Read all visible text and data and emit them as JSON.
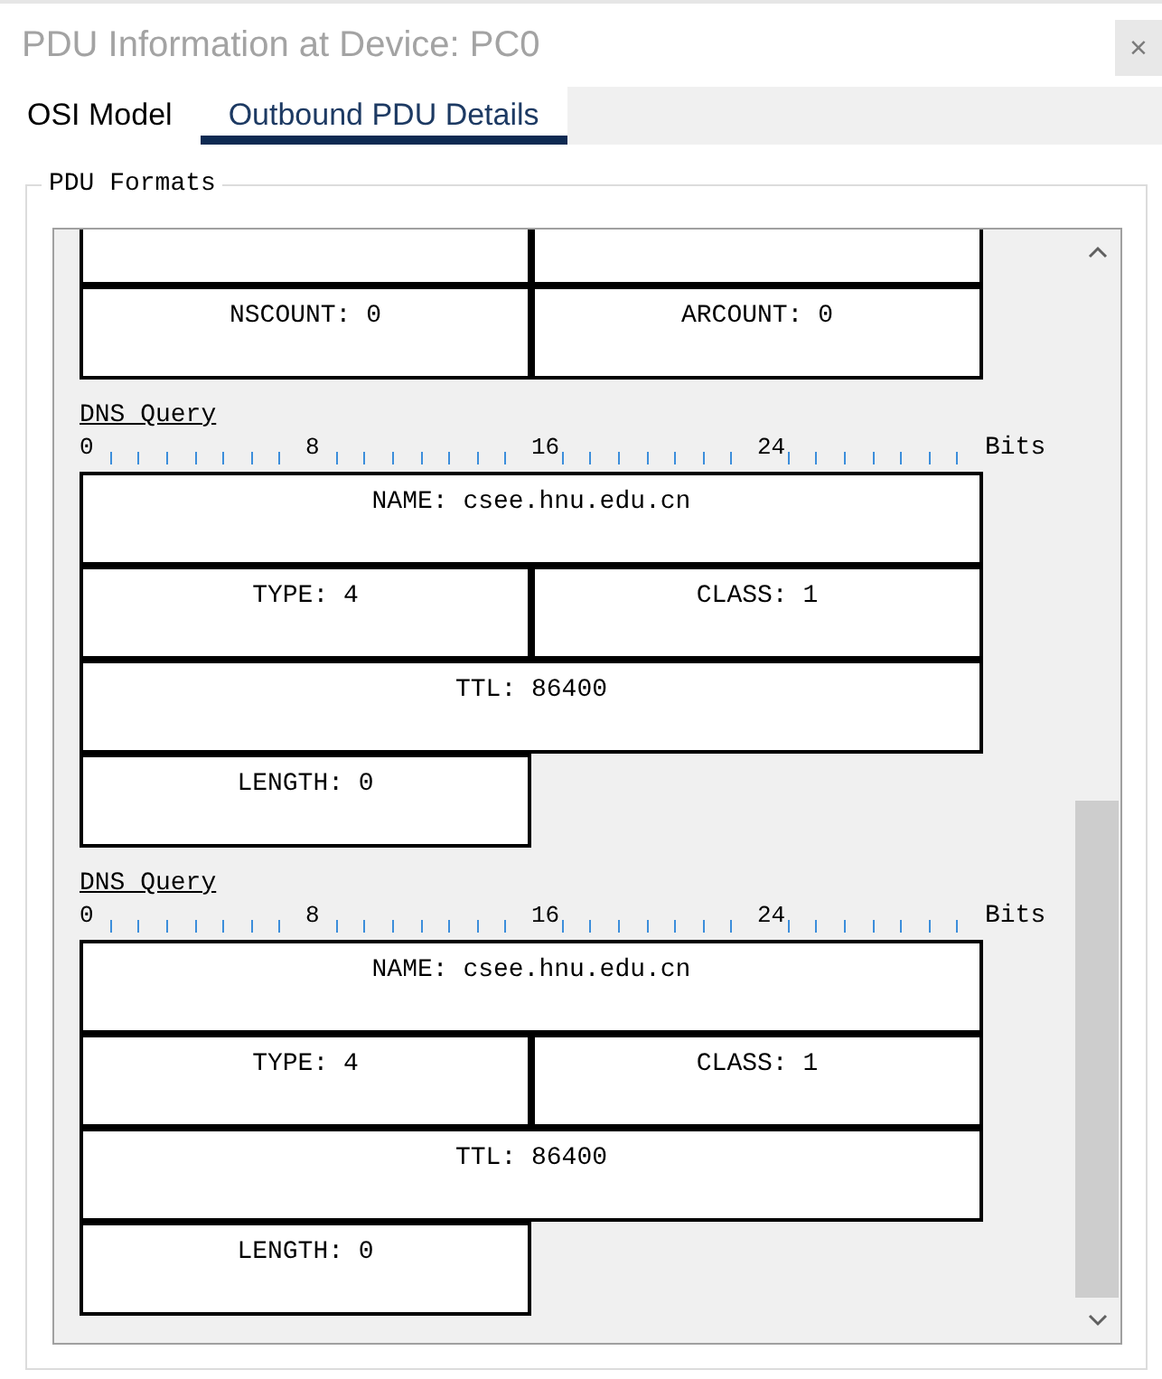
{
  "window": {
    "title": "PDU Information at Device: PC0",
    "close_button": {
      "label": "×"
    }
  },
  "tabs": [
    {
      "label": "OSI Model",
      "selected": false
    },
    {
      "label": "Outbound PDU Details",
      "selected": true
    }
  ],
  "pdu_formats": {
    "title": "PDU Formats",
    "sections": [
      {
        "rows": [
          {
            "clipped": true,
            "cells": [
              {
                "kind": "half"
              },
              {
                "kind": "half"
              }
            ]
          },
          {
            "clipped": false,
            "cells": [
              {
                "kind": "half",
                "label": "NSCOUNT: 0"
              },
              {
                "kind": "half",
                "label": "ARCOUNT: 0"
              }
            ]
          }
        ]
      },
      {
        "title": "DNS Query",
        "ruler": {
          "marks": [
            "0",
            "8",
            "16",
            "24"
          ],
          "unit": "Bits"
        },
        "rows": [
          {
            "clipped": false,
            "cells": [
              {
                "kind": "full",
                "label": "NAME: csee.hnu.edu.cn"
              }
            ]
          },
          {
            "clipped": false,
            "cells": [
              {
                "kind": "half",
                "label": "TYPE: 4"
              },
              {
                "kind": "half",
                "label": "CLASS: 1"
              }
            ]
          },
          {
            "clipped": false,
            "cells": [
              {
                "kind": "full",
                "label": "TTL: 86400"
              }
            ]
          },
          {
            "clipped": false,
            "cells": [
              {
                "kind": "half",
                "label": "LENGTH: 0"
              }
            ]
          }
        ]
      },
      {
        "title": "DNS Query",
        "ruler": {
          "marks": [
            "0",
            "8",
            "16",
            "24"
          ],
          "unit": "Bits"
        },
        "rows": [
          {
            "clipped": false,
            "cells": [
              {
                "kind": "full",
                "label": "NAME: csee.hnu.edu.cn"
              }
            ]
          },
          {
            "clipped": false,
            "cells": [
              {
                "kind": "half",
                "label": "TYPE: 4"
              },
              {
                "kind": "half",
                "label": "CLASS: 1"
              }
            ]
          },
          {
            "clipped": false,
            "cells": [
              {
                "kind": "full",
                "label": "TTL: 86400"
              }
            ]
          },
          {
            "clipped": false,
            "cells": [
              {
                "kind": "half",
                "label": "LENGTH: 0"
              }
            ]
          }
        ]
      }
    ]
  }
}
